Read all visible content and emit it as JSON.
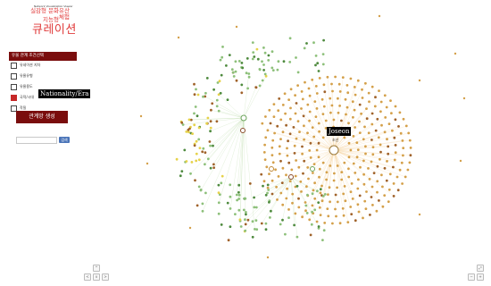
{
  "header": {
    "brand_small": "Network Visualization Viewer",
    "subtitle_line1": "실감형 문화유산 체험",
    "subtitle_line2": "지능형",
    "title": "큐레이션"
  },
  "panel": {
    "heading": "유물 관계 조건선택",
    "options": [
      {
        "label": "유네이션 지차",
        "checked": false
      },
      {
        "label": "유물유형",
        "checked": false
      },
      {
        "label": "유물용도",
        "checked": false
      },
      {
        "label": "국적/시대",
        "checked": true
      },
      {
        "label": "작질",
        "checked": false
      }
    ],
    "tooltip": "Nationality/Era",
    "generate_button": "관계망 생성",
    "search_placeholder": "",
    "search_button": "검색"
  },
  "graph": {
    "center_tooltip": "Joseon",
    "center_label": "조선",
    "colors": {
      "center_cluster": "#d4a04a",
      "left_green": "#8dc07a",
      "dark_green": "#4e8a3e",
      "yellow": "#e6d24a",
      "brown": "#a0622a",
      "edge_orange": "#f3c98a",
      "edge_green": "#b9dba8"
    }
  },
  "controls": {
    "up": "^",
    "down": "v",
    "left": "<",
    "right": ">",
    "zoom_in": "+",
    "zoom_out": "−",
    "fullscreen": "⤢"
  }
}
